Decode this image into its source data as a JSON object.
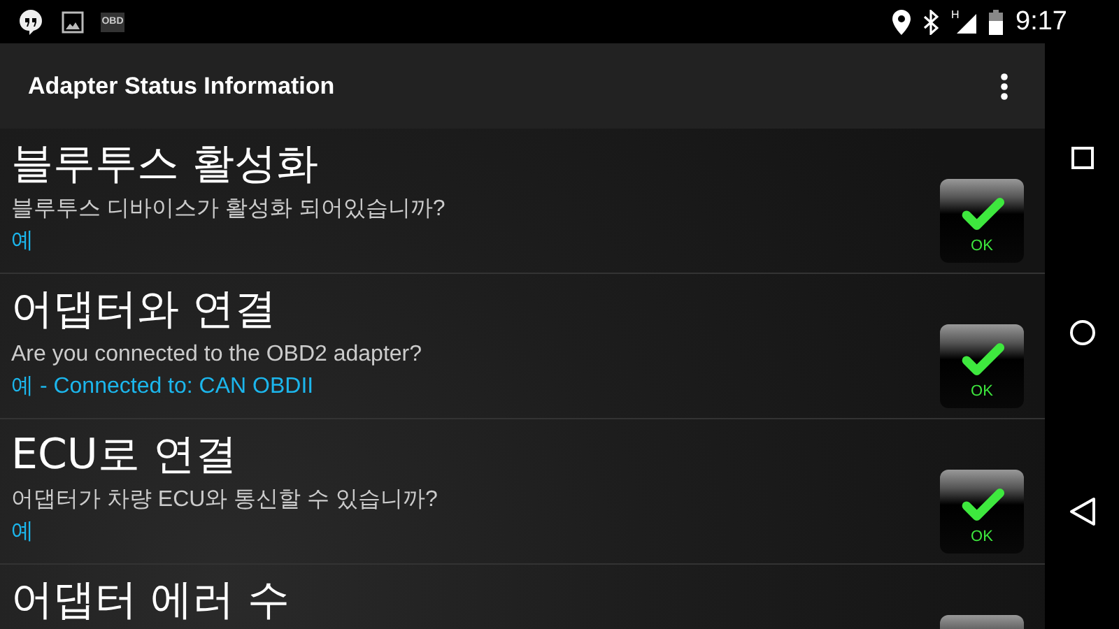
{
  "status_bar": {
    "obd_label": "OBD",
    "network_type": "H",
    "time": "9:17"
  },
  "app_bar": {
    "title": "Adapter Status Information"
  },
  "items": [
    {
      "title": "블루투스 활성화",
      "question": "블루투스 디바이스가 활성화 되어있습니까?",
      "answer": "예",
      "passed": true,
      "badge_label": "OK"
    },
    {
      "title": "어댑터와 연결",
      "question": "Are you connected to the OBD2 adapter?",
      "answer": "예 - Connected to: CAN OBDII",
      "passed": true,
      "badge_label": "OK"
    },
    {
      "title": "ECU로 연결",
      "question": "어댑터가 차량 ECU와 통신할 수 있습니까?",
      "answer": "예",
      "passed": true,
      "badge_label": "OK"
    },
    {
      "title": "어댑터 에러 수"
    }
  ]
}
